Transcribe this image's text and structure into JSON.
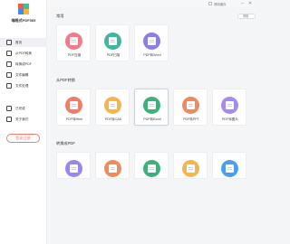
{
  "app": {
    "name": "嗨格式PDF365",
    "logo_colors": [
      "#f25a4a",
      "#3ec28f",
      "#3d8bf0",
      "#f5b83d"
    ]
  },
  "topbar": {
    "checkbox_label": "清除缓存",
    "minimize": "–",
    "close": "✕"
  },
  "sidebar": {
    "items": [
      {
        "label": "首页",
        "icon": "home-icon",
        "active": true
      },
      {
        "label": "从PDF转换",
        "icon": "convert-from-pdf-icon",
        "active": false
      },
      {
        "label": "转换成PDF",
        "icon": "convert-to-pdf-icon",
        "active": false
      },
      {
        "label": "文件编辑",
        "icon": "edit-file-icon",
        "active": false
      },
      {
        "label": "文件处理",
        "icon": "process-file-icon",
        "active": false
      },
      {
        "label": "已完成",
        "icon": "done-icon",
        "active": false
      },
      {
        "label": "关于我们",
        "icon": "about-icon",
        "active": false
      }
    ],
    "login_label": "登录/注册"
  },
  "main": {
    "more_label": "帮助",
    "sections": [
      {
        "title": "常用",
        "cards": [
          {
            "label": "PDF压缩",
            "color": "#f27b8a"
          },
          {
            "label": "PDF扫描",
            "color": "#3fb6a0"
          },
          {
            "label": "PDF转Word",
            "color": "#8a7ee8"
          }
        ]
      },
      {
        "title": "从PDF转换",
        "cards": [
          {
            "label": "PDF转Html",
            "color": "#f07c6a"
          },
          {
            "label": "PDF转CAD",
            "color": "#f5b54a"
          },
          {
            "label": "PDF转Excel",
            "color": "#3eb07a"
          },
          {
            "label": "PDF转PPT",
            "color": "#f08a5a"
          },
          {
            "label": "PDF转图片",
            "color": "#a58af0"
          }
        ]
      },
      {
        "title": "转换成PDF",
        "cards": [
          {
            "label": "",
            "color": "#9a86ee"
          },
          {
            "label": "",
            "color": "#f08a5a"
          },
          {
            "label": "",
            "color": "#3fb07a"
          },
          {
            "label": "",
            "color": "#f5b54a"
          },
          {
            "label": "",
            "color": "#4a9ef0"
          }
        ]
      }
    ]
  }
}
